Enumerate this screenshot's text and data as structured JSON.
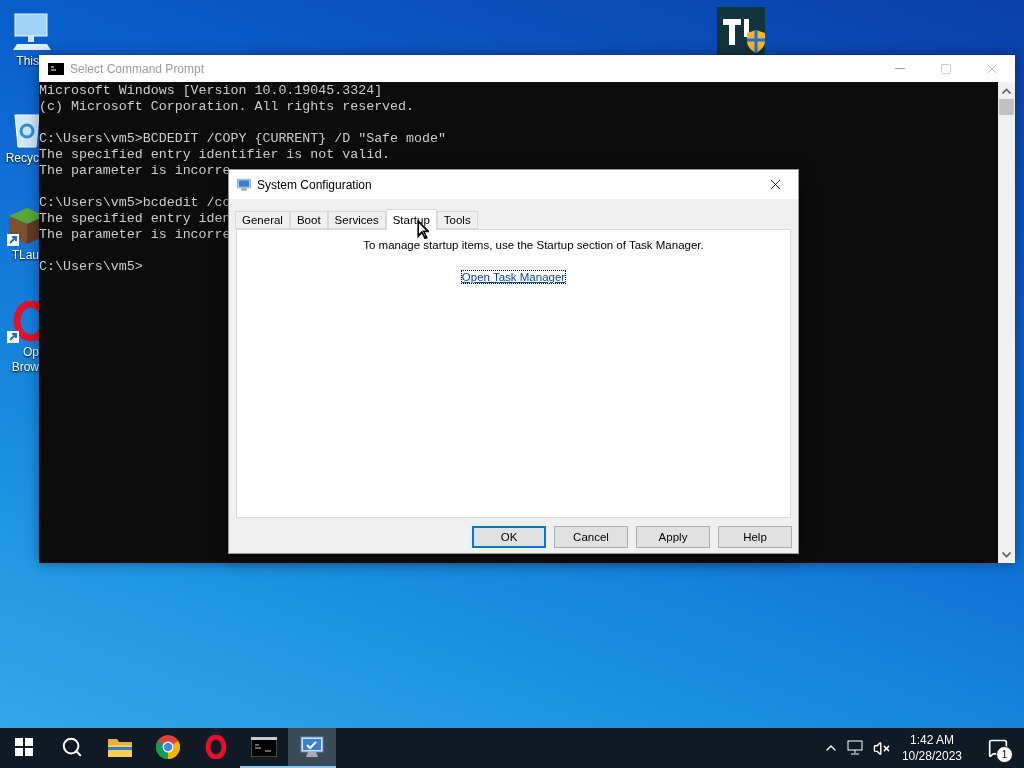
{
  "desktop_icons": [
    {
      "kind": "computer",
      "lines": [
        "This"
      ]
    },
    {
      "kind": "recycle",
      "lines": [
        "Recyc"
      ]
    },
    {
      "kind": "game",
      "lines": [
        "TLau"
      ]
    },
    {
      "kind": "browser",
      "lines": [
        "Op",
        "Brow"
      ]
    },
    {
      "kind": "shield-app"
    }
  ],
  "console": {
    "title": "Select Command Prompt",
    "blocks": [
      [
        "Microsoft Windows [Version 10.0.19045.3324]",
        "(c) Microsoft Corporation. All rights reserved."
      ],
      [
        "C:\\Users\\vm5>BCDEDIT /COPY {CURRENT} /D \"Safe mode\"",
        "The specified entry identifier is not valid.",
        "The parameter is incorre"
      ],
      [
        "C:\\Users\\vm5>bcdedit /co",
        "The specified entry iden",
        "The parameter is incorre"
      ],
      [
        "C:\\Users\\vm5>"
      ]
    ]
  },
  "dialog": {
    "title": "System Configuration",
    "tabs": [
      {
        "label": "General",
        "selected": false
      },
      {
        "label": "Boot",
        "selected": false
      },
      {
        "label": "Services",
        "selected": false
      },
      {
        "label": "Startup",
        "selected": true
      },
      {
        "label": "Tools",
        "selected": false
      }
    ],
    "message": "To manage startup items, use the Startup section of Task Manager.",
    "link": "Open Task Manager",
    "buttons": [
      {
        "label": "OK",
        "focused": true
      },
      {
        "label": "Cancel",
        "focused": false
      },
      {
        "label": "Apply",
        "focused": false
      },
      {
        "label": "Help",
        "focused": false
      }
    ]
  },
  "taskbar": {
    "apps": [
      {
        "kind": "search",
        "running": false,
        "selected": false
      },
      {
        "kind": "folder",
        "running": false,
        "selected": false
      },
      {
        "kind": "chrome",
        "running": false,
        "selected": false
      },
      {
        "kind": "opera",
        "running": false,
        "selected": false
      },
      {
        "kind": "console",
        "running": true,
        "selected": false
      },
      {
        "kind": "sysconfig",
        "running": true,
        "selected": true
      }
    ],
    "time": "1:42 AM",
    "date": "10/28/2023",
    "notification_count": "1"
  }
}
